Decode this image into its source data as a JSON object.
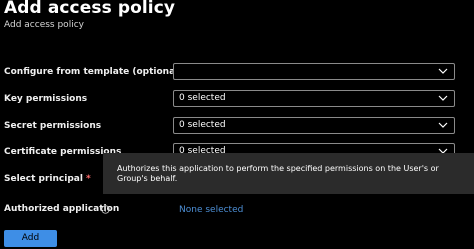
{
  "header": {
    "title": "Add access policy",
    "subtitle": "Add access policy"
  },
  "form": {
    "template": {
      "label": "Configure from template (optional)",
      "value": ""
    },
    "key_permissions": {
      "label": "Key permissions",
      "value": "0 selected"
    },
    "secret_permissions": {
      "label": "Secret permissions",
      "value": "0 selected"
    },
    "certificate_permissions": {
      "label": "Certificate permissions",
      "value": "0 selected"
    },
    "select_principal": {
      "label": "Select principal",
      "required_mark": "*"
    },
    "authorized_application": {
      "label": "Authorized application",
      "value": "None selected"
    }
  },
  "tooltip": {
    "text": "Authorizes this application to perform the specified permissions on the User's or Group's behalf."
  },
  "actions": {
    "add_label": "Add"
  },
  "icons": {
    "dropdown": "chevron-down-icon",
    "info": "info-icon"
  },
  "colors": {
    "background": "#000000",
    "link": "#4d8fd6",
    "primary_button": "#3e8ee6",
    "tooltip_background": "#2b2b2b",
    "required": "#ff6b6b"
  }
}
